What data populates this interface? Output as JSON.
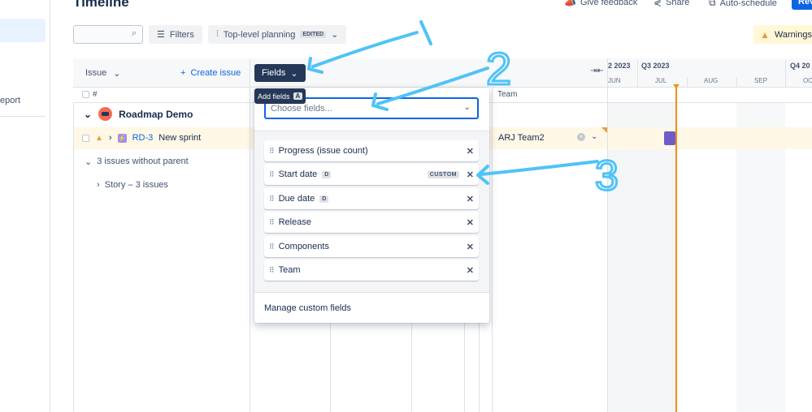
{
  "page": {
    "title": "Timeline"
  },
  "nav": {
    "report_label": "eport"
  },
  "header": {
    "give_feedback": "Give feedback",
    "share": "Share",
    "auto_schedule": "Auto-schedule",
    "review": "Rev"
  },
  "toolbar": {
    "search_placeholder": "",
    "filters": "Filters",
    "planning": "Top-level planning",
    "planning_tag": "EDITED",
    "warnings": "Warnings"
  },
  "table": {
    "issue_label": "Issue",
    "create_issue": "Create issue",
    "fields_label": "Fields",
    "hash": "#",
    "team_header": "Team",
    "project_name": "Roadmap Demo",
    "issue_key": "RD-3",
    "issue_summary": "New sprint",
    "team_value": "ARJ Team2",
    "group_label": "3 issues without parent",
    "story_label": "Story – 3 issues"
  },
  "timeline": {
    "quarters": [
      "2 2023",
      "Q3 2023",
      "Q4 20"
    ],
    "months": [
      "JUN",
      "JUL",
      "AUG",
      "SEP",
      "OC"
    ]
  },
  "fields_popup": {
    "tooltip": "Add fields",
    "tooltip_key": "A",
    "choose_placeholder": "Choose fields...",
    "items": [
      {
        "label": "Progress (issue count)",
        "badge": "",
        "custom": ""
      },
      {
        "label": "Start date",
        "badge": "D",
        "custom": "CUSTOM"
      },
      {
        "label": "Due date",
        "badge": "D",
        "custom": ""
      },
      {
        "label": "Release",
        "badge": "",
        "custom": ""
      },
      {
        "label": "Components",
        "badge": "",
        "custom": ""
      },
      {
        "label": "Team",
        "badge": "",
        "custom": ""
      }
    ],
    "manage": "Manage custom fields"
  },
  "annotations": {
    "two": "2",
    "three": "3"
  },
  "colors": {
    "accent": "#0c66e4",
    "now_line": "#f18d13",
    "annotation": "#4fc3f7",
    "bar": "#6e5dc6"
  }
}
